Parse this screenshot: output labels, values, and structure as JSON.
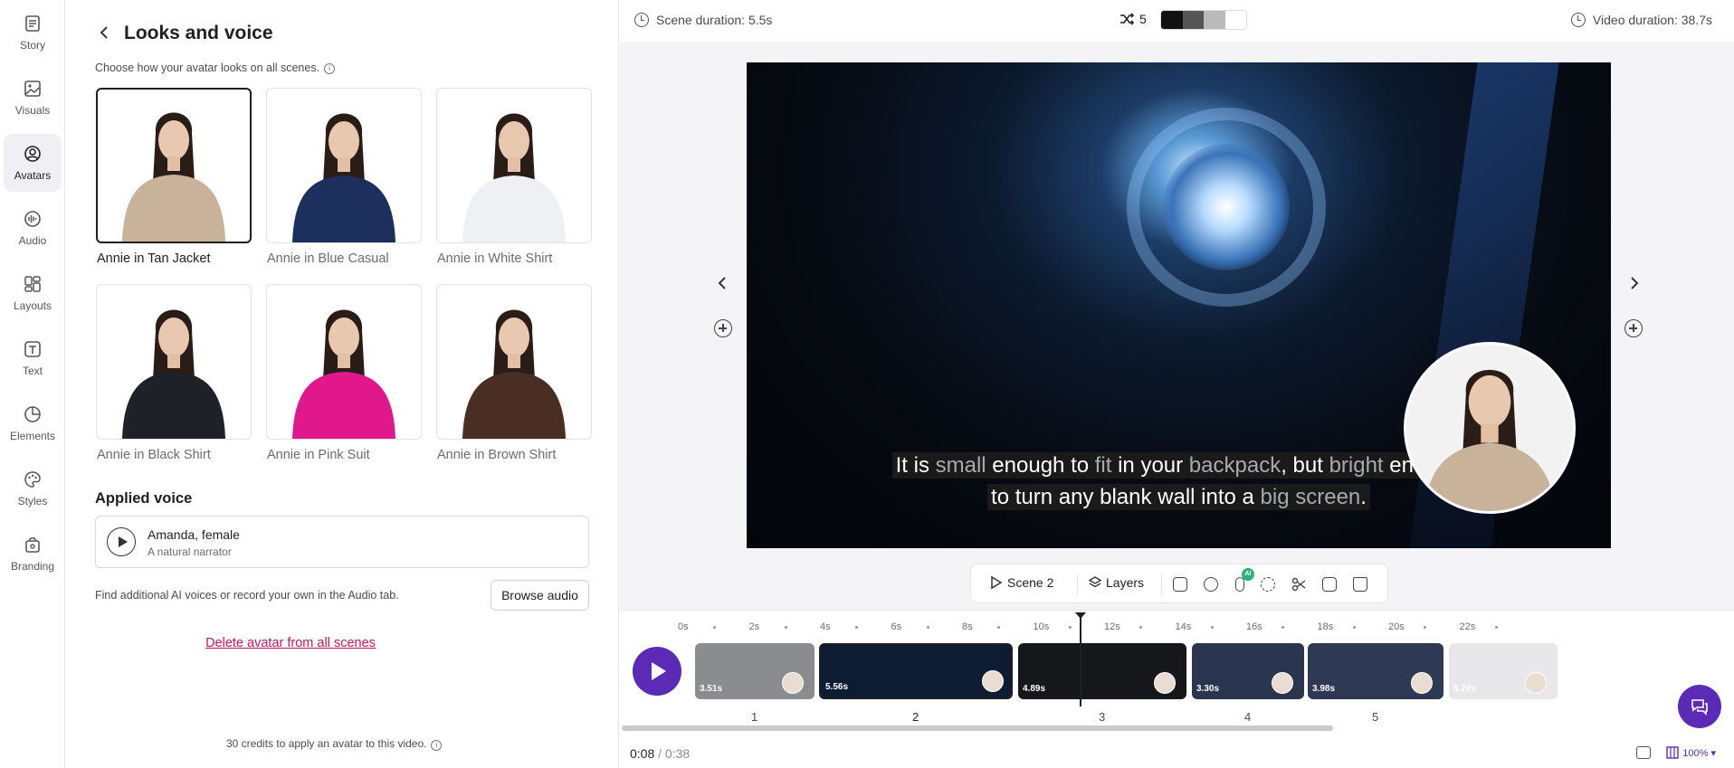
{
  "rail": {
    "items": [
      {
        "label": "Story",
        "icon": "story-icon"
      },
      {
        "label": "Visuals",
        "icon": "image-icon"
      },
      {
        "label": "Avatars",
        "icon": "avatar-icon",
        "active": true
      },
      {
        "label": "Audio",
        "icon": "audio-icon"
      },
      {
        "label": "Layouts",
        "icon": "layouts-icon"
      },
      {
        "label": "Text",
        "icon": "text-icon"
      },
      {
        "label": "Elements",
        "icon": "elements-icon"
      },
      {
        "label": "Styles",
        "icon": "palette-icon"
      },
      {
        "label": "Branding",
        "icon": "branding-icon"
      }
    ]
  },
  "panel": {
    "title": "Looks and voice",
    "hint": "Choose how your avatar looks on all scenes.",
    "looks": [
      {
        "label": "Annie in Tan Jacket",
        "selected": true,
        "outfit": "#c8b29a"
      },
      {
        "label": "Annie in Blue Casual",
        "outfit": "#1d2f5c"
      },
      {
        "label": "Annie in White Shirt",
        "outfit": "#eef0f3"
      },
      {
        "label": "Annie in Black Shirt",
        "outfit": "#1e2228"
      },
      {
        "label": "Annie in Pink Suit",
        "outfit": "#e0188c"
      },
      {
        "label": "Annie in Brown Shirt",
        "outfit": "#4a2e24"
      }
    ],
    "voice_title": "Applied voice",
    "voice_name": "Amanda, female",
    "voice_desc": "A natural narrator",
    "voice_note": "Find additional AI voices or record your own in the Audio tab.",
    "browse_label": "Browse audio",
    "delete_label": "Delete avatar from all scenes",
    "credits": "30 credits to apply an avatar to this video."
  },
  "editor": {
    "scene_duration": "Scene duration: 5.5s",
    "shuffle_count": "5",
    "video_duration": "Video duration: 38.7s",
    "swatch_colors": [
      "#111111",
      "#555555",
      "#bbbbbb",
      "#ffffff"
    ],
    "subtitle": {
      "line1": [
        {
          "t": "It is ",
          "dim": false
        },
        {
          "t": "small",
          "dim": true
        },
        {
          "t": " enough to ",
          "dim": false
        },
        {
          "t": "fit",
          "dim": true
        },
        {
          "t": " in your ",
          "dim": false
        },
        {
          "t": "backpack",
          "dim": true
        },
        {
          "t": ", but ",
          "dim": false
        },
        {
          "t": "bright",
          "dim": true
        },
        {
          "t": " enough",
          "dim": false
        }
      ],
      "line2": [
        {
          "t": "to turn any blank wall into a ",
          "dim": false
        },
        {
          "t": "big screen",
          "dim": true
        },
        {
          "t": ".",
          "dim": false
        }
      ]
    },
    "toolbar": {
      "scene_label": "Scene 2",
      "layers_label": "Layers",
      "ai_badge": "AI"
    }
  },
  "timeline": {
    "ticks": [
      "0s",
      "2s",
      "4s",
      "6s",
      "8s",
      "10s",
      "12s",
      "14s",
      "16s",
      "18s",
      "20s",
      "22s"
    ],
    "clips": [
      {
        "duration": "3.51s",
        "scene": "1",
        "bg": "#8a8c90"
      },
      {
        "duration": "5.56s",
        "scene": "2",
        "bg": "#0d1c33",
        "selected": true
      },
      {
        "duration": "4.89s",
        "scene": "3",
        "bg": "#15171b"
      },
      {
        "duration": "3.30s",
        "scene": "4",
        "bg": "#2a3550"
      },
      {
        "duration": "3.98s",
        "scene": "5",
        "bg": "#2e3a55"
      },
      {
        "duration": "5.79s",
        "scene": "",
        "bg": "#e8e8ea"
      }
    ],
    "current_time": "0:08",
    "total_time": "/ 0:38",
    "zoom": "100%"
  }
}
